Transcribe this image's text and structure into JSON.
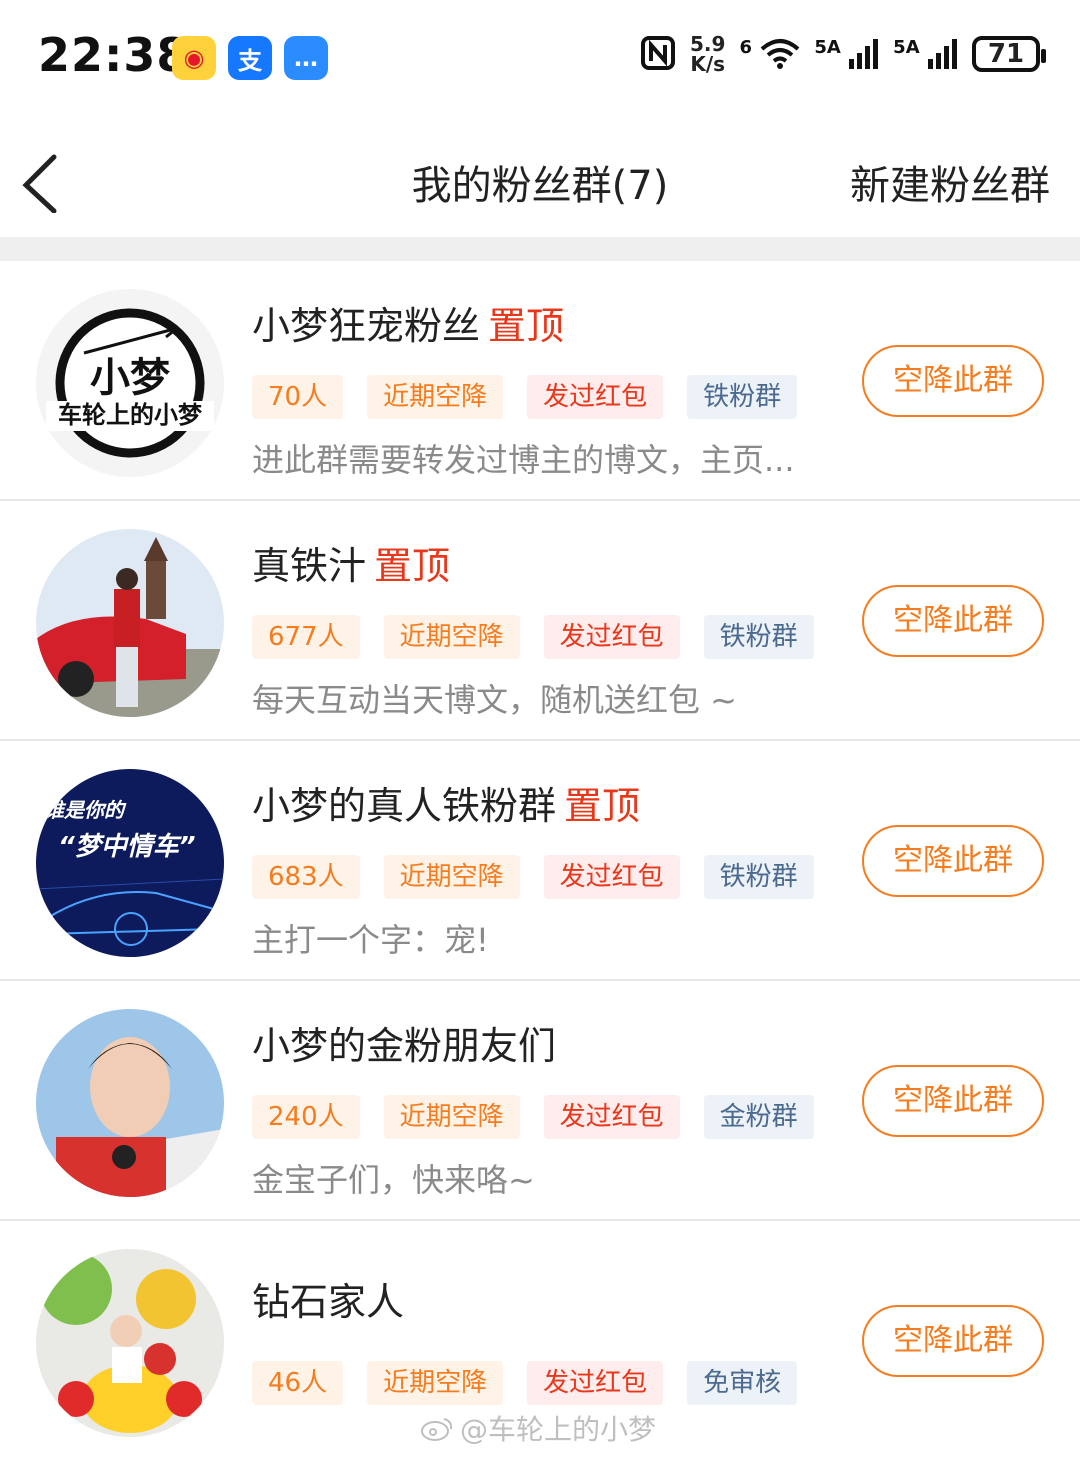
{
  "status_bar": {
    "time": "22:38",
    "net_speed_value": "5.9",
    "net_speed_unit": "K/s",
    "wifi_label": "6",
    "signal1": "5A",
    "signal2": "5A",
    "battery": "71",
    "apps": [
      {
        "icon": "weibo-icon",
        "glyph": "◉"
      },
      {
        "icon": "alipay-icon",
        "glyph": "支"
      },
      {
        "icon": "message-icon",
        "glyph": "…"
      }
    ]
  },
  "header": {
    "title": "我的粉丝群(7)",
    "new_group": "新建粉丝群"
  },
  "pin_label": "置顶",
  "join_label": "空降此群",
  "groups": [
    {
      "name": "小梦狂宠粉丝",
      "pinned": true,
      "count": "70人",
      "tags": [
        "近期空降",
        "发过红包",
        "铁粉群"
      ],
      "desc": "进此群需要转发过博主的博文，主页..."
    },
    {
      "name": "真铁汁",
      "pinned": true,
      "count": "677人",
      "tags": [
        "近期空降",
        "发过红包",
        "铁粉群"
      ],
      "desc": "每天互动当天博文，随机送红包 ~"
    },
    {
      "name": "小梦的真人铁粉群",
      "pinned": true,
      "count": "683人",
      "tags": [
        "近期空降",
        "发过红包",
        "铁粉群"
      ],
      "desc": "主打一个字：宠!"
    },
    {
      "name": "小梦的金粉朋友们",
      "pinned": false,
      "count": "240人",
      "tags": [
        "近期空降",
        "发过红包",
        "金粉群"
      ],
      "desc": "金宝子们，快来咯~"
    },
    {
      "name": "钻石家人",
      "pinned": false,
      "count": "46人",
      "tags": [
        "近期空降",
        "发过红包",
        "免审核"
      ],
      "desc": ""
    }
  ],
  "avatar_text": {
    "g1_big": "小梦",
    "g1_small": "车轮上的小梦",
    "g3_line1": "谁是你的",
    "g3_line2": "“梦中情车”"
  },
  "watermark": "@车轮上的小梦"
}
